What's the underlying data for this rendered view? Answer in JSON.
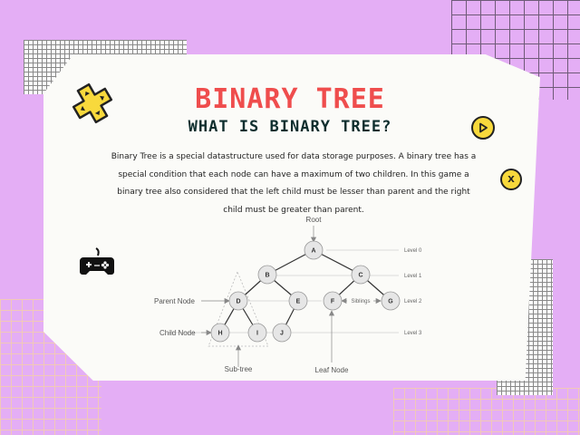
{
  "header": {
    "title": "BINARY TREE",
    "subtitle": "WHAT IS BINARY TREE?"
  },
  "description": "Binary Tree is a special datastructure used for data storage purposes. A binary tree has a special condition that each node can have a maximum of two children. In this game a binary tree also considered that the left child must be lesser than parent and the right child must be greater than parent.",
  "controls": {
    "play_icon": "play-icon",
    "close_label": "X"
  },
  "icons": {
    "dpad": "dpad-icon",
    "gamepad": "gamepad-icon"
  },
  "diagram": {
    "root_label": "Root",
    "parent_node_label": "Parent Node",
    "child_node_label": "Child Node",
    "subtree_label": "Sub-tree",
    "leaf_node_label": "Leaf Node",
    "siblings_label": "Siblings",
    "levels": [
      "Level 0",
      "Level 1",
      "Level 2",
      "Level 3"
    ],
    "nodes": [
      "A",
      "B",
      "C",
      "D",
      "E",
      "F",
      "G",
      "H",
      "I",
      "J"
    ]
  },
  "colors": {
    "background": "#e4aef5",
    "title": "#ef4d4d",
    "subtitle": "#0e2e2e",
    "button_fill": "#f8d93c"
  }
}
